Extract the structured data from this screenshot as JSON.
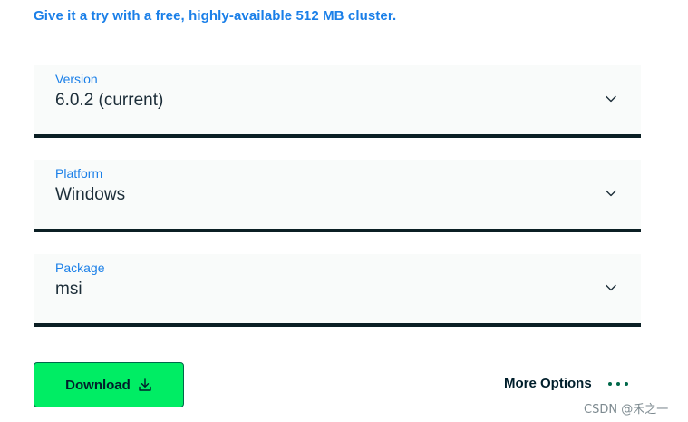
{
  "promo": {
    "text": "Give it a try with a free, highly-available 512 MB cluster."
  },
  "selects": {
    "version": {
      "label": "Version",
      "value": "6.0.2 (current)"
    },
    "platform": {
      "label": "Platform",
      "value": "Windows"
    },
    "package": {
      "label": "Package",
      "value": "msi"
    }
  },
  "actions": {
    "download_label": "Download",
    "more_options_label": "More Options"
  },
  "watermark": {
    "text": "CSDN @禾之一"
  },
  "icons": {
    "chevron": "chevron-down-icon",
    "download": "download-icon",
    "more": "ellipsis-icon"
  },
  "colors": {
    "accent_blue": "#1a7fe8",
    "brand_green": "#00ed64",
    "dark_green": "#00684a",
    "underline": "#0b1f24"
  }
}
